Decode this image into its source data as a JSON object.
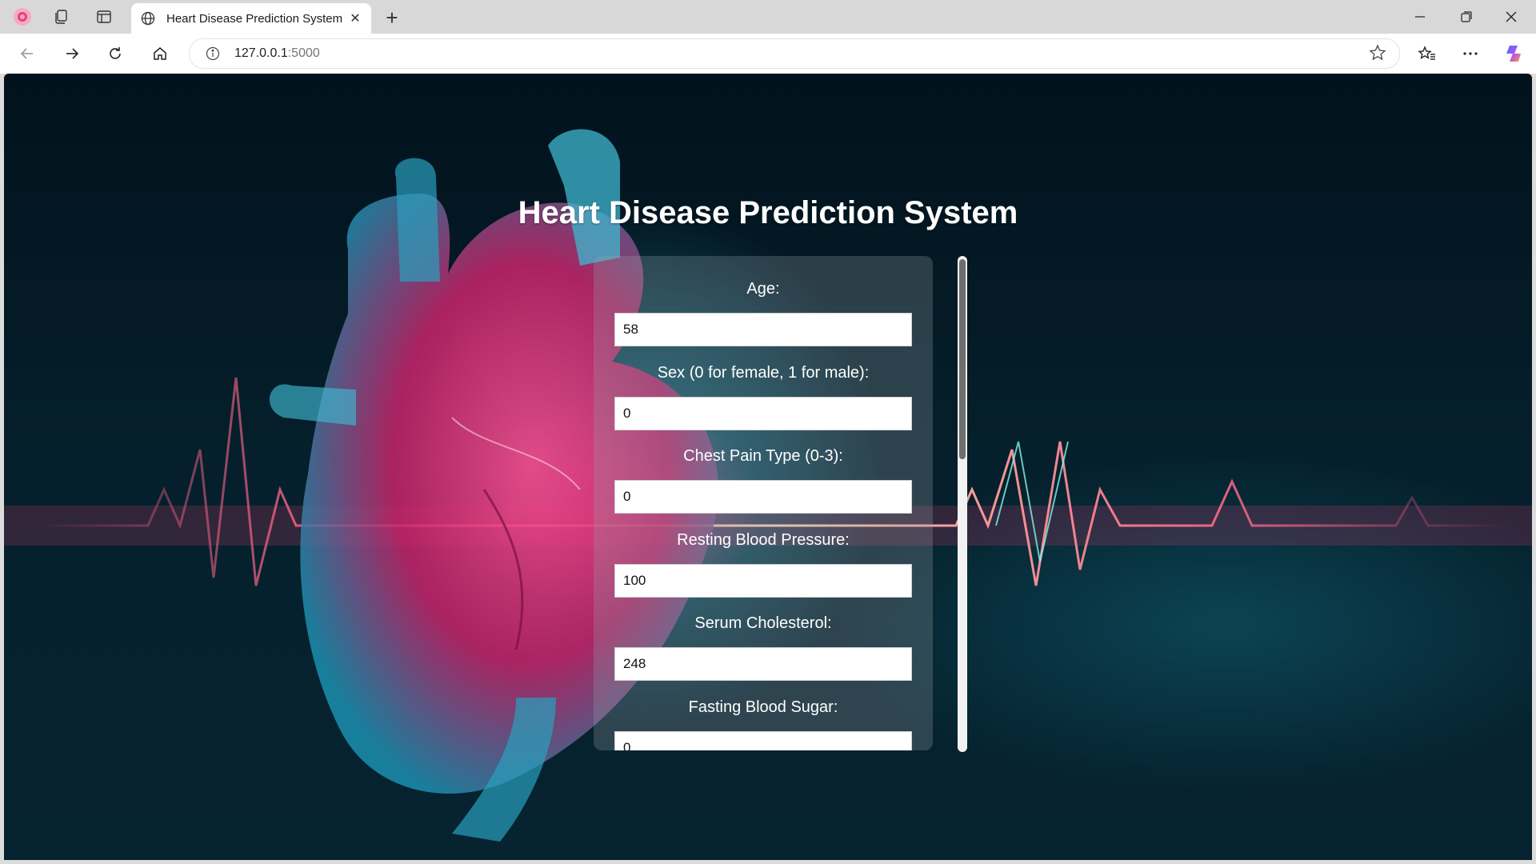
{
  "browser": {
    "tab_title": "Heart Disease Prediction System",
    "url_host": "127.0.0.1",
    "url_port": ":5000",
    "new_tab_symbol": "+",
    "tab_close_symbol": "✕",
    "icons": [
      "profile-icon",
      "collections-icon",
      "tab-actions-icon",
      "globe-icon",
      "back-icon",
      "forward-icon",
      "refresh-icon",
      "home-icon",
      "info-icon",
      "star-icon",
      "favorites-icon",
      "more-icon",
      "copilot-icon",
      "minimize-icon",
      "restore-icon",
      "close-icon"
    ],
    "colors": {
      "tabbar": "#d8d8d8",
      "toolbar": "#ffffff"
    }
  },
  "page": {
    "title": "Heart Disease Prediction System",
    "colors": {
      "title": "#ffffff",
      "background": "#05202c",
      "accent_pink": "#ff3c8c",
      "accent_cyan": "#1ea0be"
    }
  },
  "form": {
    "fields": [
      {
        "label": "Age:",
        "value": "58"
      },
      {
        "label": "Sex (0 for female, 1 for male):",
        "value": "0"
      },
      {
        "label": "Chest Pain Type (0-3):",
        "value": "0"
      },
      {
        "label": "Resting Blood Pressure:",
        "value": "100"
      },
      {
        "label": "Serum Cholesterol:",
        "value": "248"
      },
      {
        "label": "Fasting Blood Sugar:",
        "value": "0"
      }
    ]
  }
}
